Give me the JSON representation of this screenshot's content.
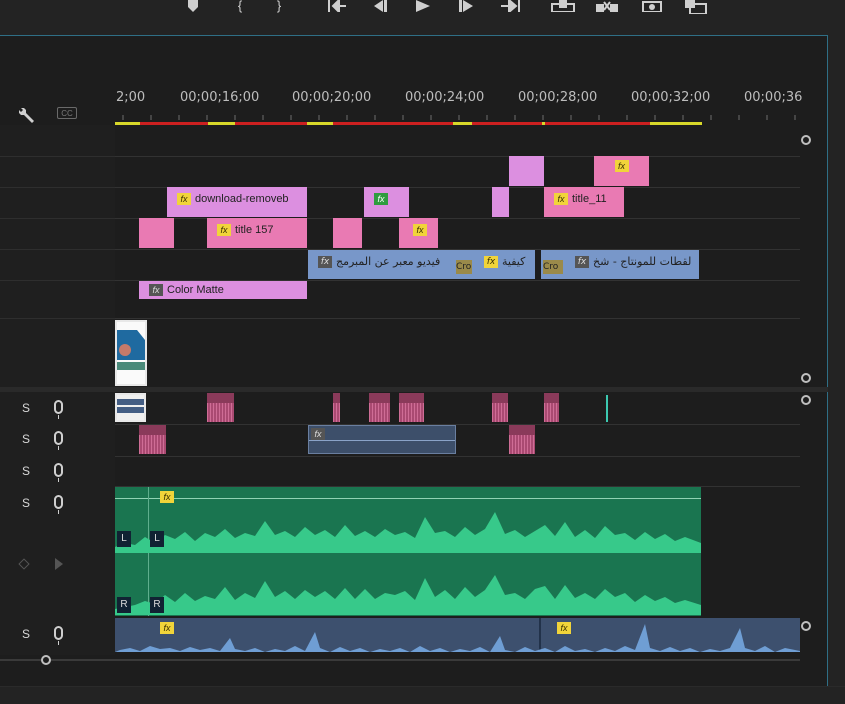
{
  "toolbar": {
    "icons": [
      "marker-icon",
      "mark-in-icon",
      "mark-out-icon",
      "go-to-in-icon",
      "step-back-icon",
      "play-icon",
      "step-forward-icon",
      "go-to-out-icon",
      "lift-icon",
      "extract-icon",
      "export-frame-icon",
      "multi-camera-icon"
    ]
  },
  "timeline": {
    "ruler": [
      "2;00",
      "00;00;16;00",
      "00;00;20;00",
      "00;00;24;00",
      "00;00;28;00",
      "00;00;32;00",
      "00;00;36"
    ],
    "header": {
      "cc_label": "CC"
    },
    "clips": {
      "download": "download-removeb",
      "title157": "title  157",
      "title11": "title_11",
      "arabic1": "فيديو معبر عن المبرمج",
      "arabic2": "كيفية",
      "arabic3": "لقطات للمونتاج - شخ",
      "color_matte": "Color Matte",
      "fx": "fx",
      "cr": "Cro"
    },
    "audio": {
      "solo": "S",
      "left_channel": "L",
      "right_channel": "R"
    }
  }
}
